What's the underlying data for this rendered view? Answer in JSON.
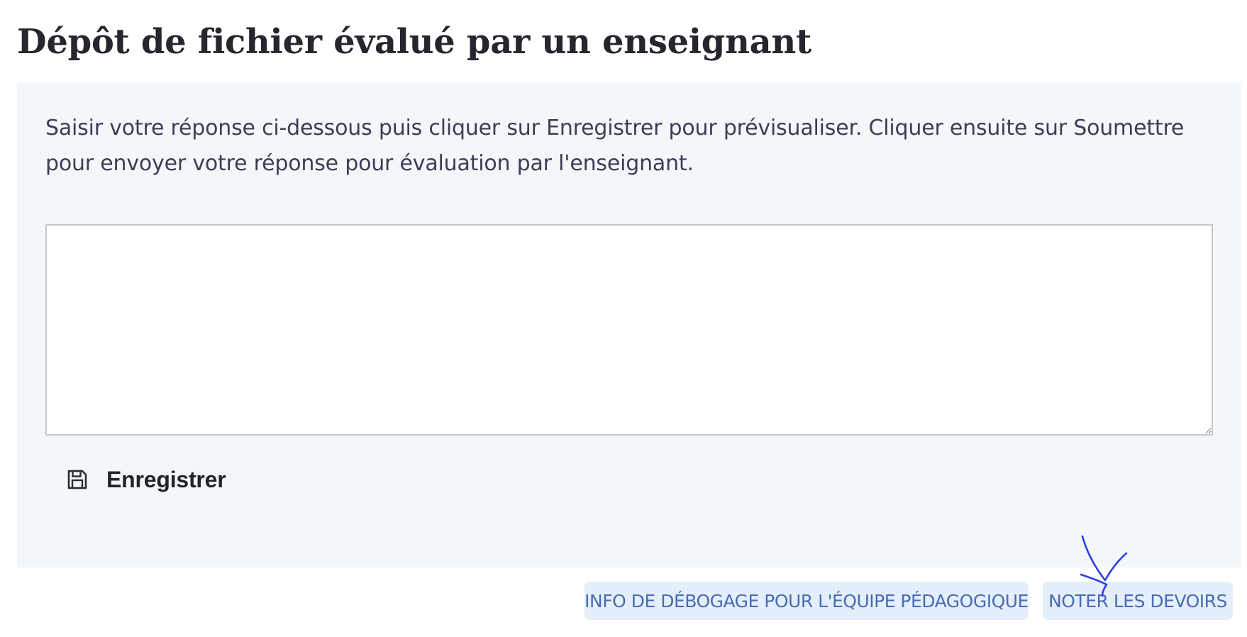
{
  "page": {
    "title": "Dépôt de fichier évalué par un enseignant"
  },
  "panel": {
    "instructions": "Saisir votre réponse ci-dessous puis cliquer sur Enregistrer pour prévisualiser. Cliquer ensuite sur Soumettre pour envoyer votre réponse pour évaluation par l'enseignant.",
    "answer_value": "",
    "save_icon": "floppy-disk-icon",
    "save_label": "Enregistrer"
  },
  "footer": {
    "debug_label": "INFO DE DÉBOGAGE POUR L'ÉQUIPE PÉDAGOGIQUE",
    "grade_label": "NOTER LES DEVOIRS"
  },
  "colors": {
    "panel_bg": "#f4f7fa",
    "footer_button_bg": "#e5effc",
    "footer_button_text": "#4a6cb4",
    "annotation_arrow": "#2f3fe0"
  }
}
